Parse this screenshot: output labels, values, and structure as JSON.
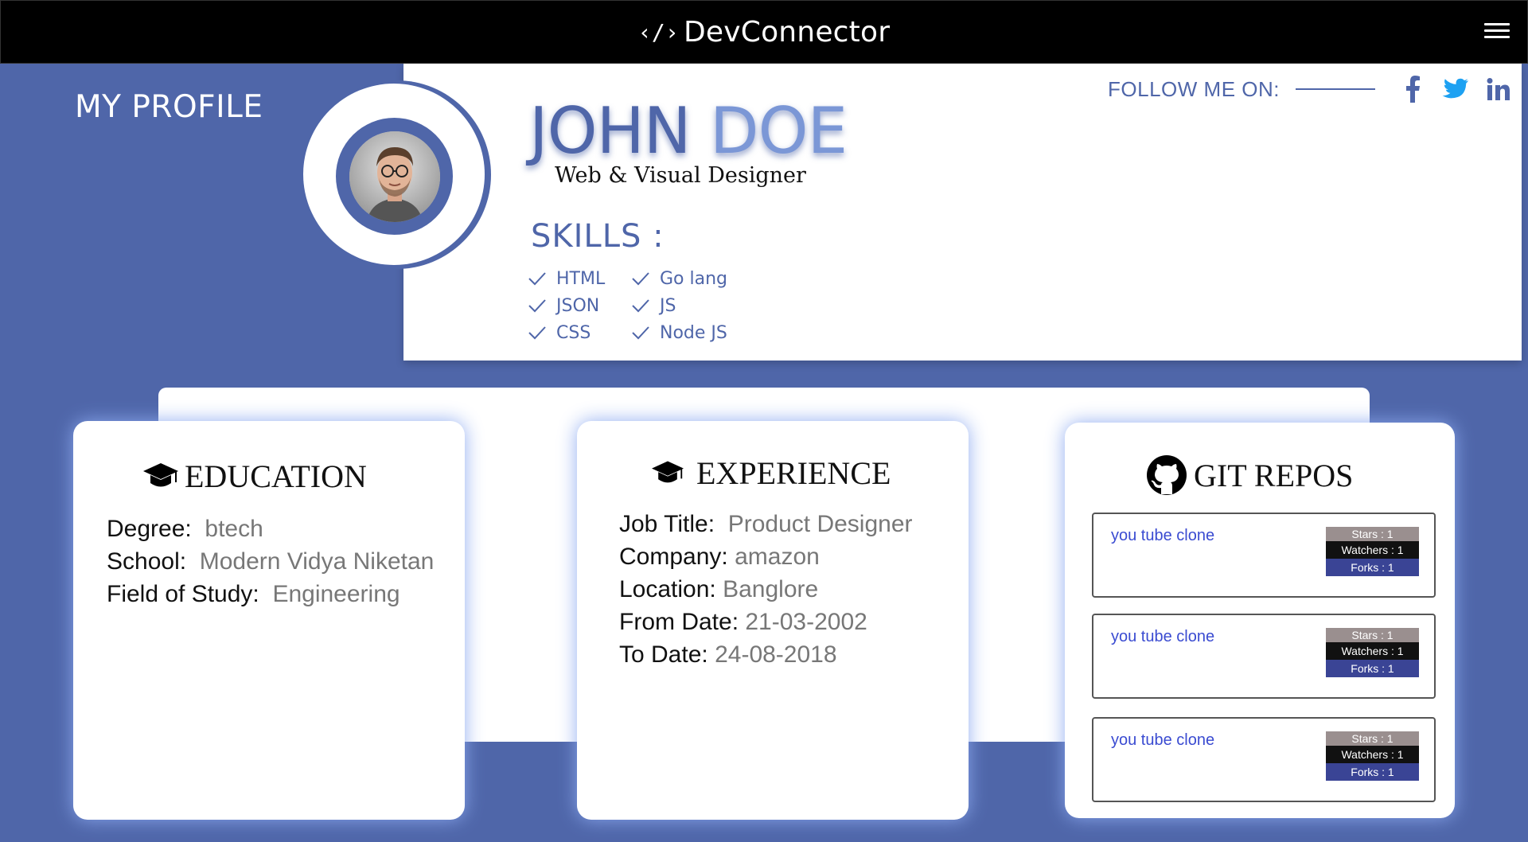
{
  "nav": {
    "brand_symbol": "‹/›",
    "brand_name": "DevConnector",
    "menu_icon": "hamburger-icon"
  },
  "header": {
    "title": "MY PROFILE"
  },
  "profile": {
    "first_name": "JOHN",
    "last_name": "DOE",
    "role": "Web & Visual Designer",
    "skills_title": "SKILLS :",
    "skills": [
      "HTML",
      "Go lang",
      "JSON",
      "JS",
      "CSS",
      "Node JS"
    ],
    "follow_label": "FOLLOW ME ON:",
    "social": [
      "facebook-icon",
      "twitter-icon",
      "linkedin-icon"
    ]
  },
  "education": {
    "title": "EDUCATION",
    "degree_label": "Degree:",
    "degree": "btech",
    "school_label": "School:",
    "school": "Modern Vidya Niketan",
    "field_label": "Field of Study:",
    "field": "Engineering"
  },
  "experience": {
    "title": "EXPERIENCE",
    "job_label": "Job Title:",
    "job": "Product Designer",
    "company_label": "Company:",
    "company": "amazon",
    "location_label": "Location:",
    "location": "Banglore",
    "from_label": "From Date:",
    "from": "21-03-2002",
    "to_label": "To Date:",
    "to": "24-08-2018"
  },
  "git": {
    "title": "GIT REPOS",
    "repos": [
      {
        "name": "you tube clone",
        "stars": "Stars : 1",
        "watchers": "Watchers : 1",
        "forks": "Forks : 1"
      },
      {
        "name": "you tube clone",
        "stars": "Stars : 1",
        "watchers": "Watchers : 1",
        "forks": "Forks : 1"
      },
      {
        "name": "you tube clone",
        "stars": "Stars : 1",
        "watchers": "Watchers : 1",
        "forks": "Forks : 1"
      }
    ]
  },
  "colors": {
    "accent": "#4f66a9",
    "accent_light": "#7b97d6",
    "nav_bg": "#000000",
    "link": "#3a4bd1"
  }
}
